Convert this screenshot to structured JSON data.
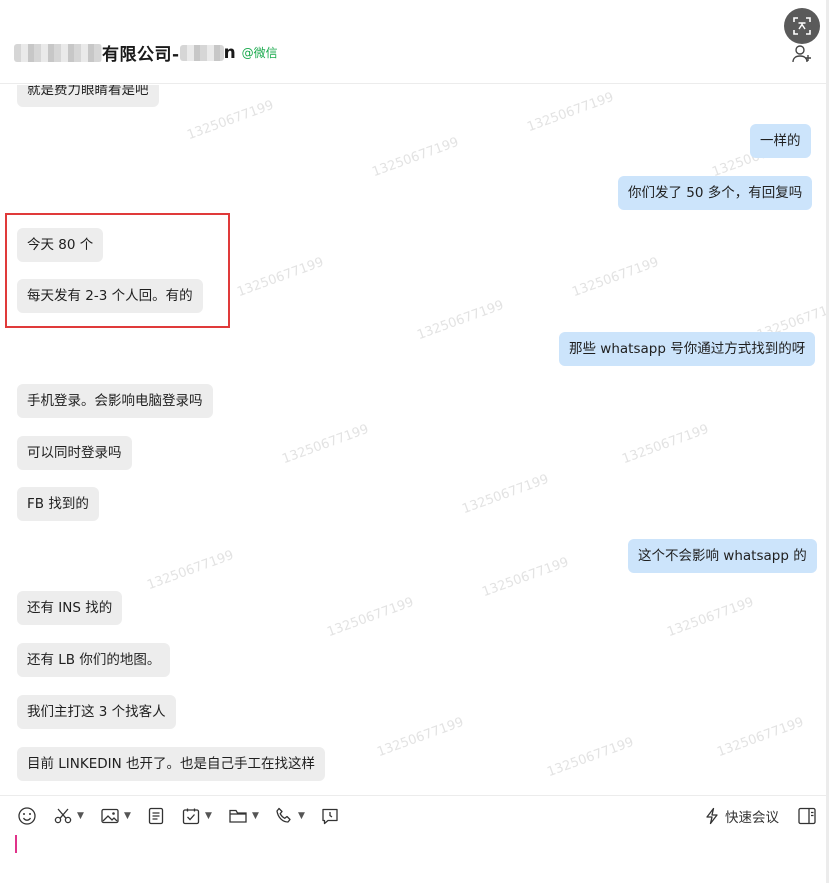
{
  "header": {
    "title": "有限公司-",
    "title_suffix": "n",
    "channel_tag": "@微信"
  },
  "watermark": "13250677199",
  "messages": [
    {
      "side": "left",
      "text": "就是费力眼睛看是吧"
    },
    {
      "side": "right",
      "text": "一样的"
    },
    {
      "side": "right",
      "text": "你们发了 50 多个，有回复吗"
    },
    {
      "side": "left",
      "text": "今天 80 个"
    },
    {
      "side": "left",
      "text": "每天发有 2-3 个人回。有的"
    },
    {
      "side": "right",
      "text": "那些 whatsapp 号你通过方式找到的呀"
    },
    {
      "side": "left",
      "text": "手机登录。会影响电脑登录吗"
    },
    {
      "side": "left",
      "text": "可以同时登录吗"
    },
    {
      "side": "left",
      "text": "FB 找到的"
    },
    {
      "side": "right",
      "text": "这个不会影响 whatsapp 的"
    },
    {
      "side": "left",
      "text": "还有 INS 找的"
    },
    {
      "side": "left",
      "text": "还有 LB 你们的地图。"
    },
    {
      "side": "left",
      "text": "我们主打这 3 个找客人"
    },
    {
      "side": "left",
      "text": "目前 LINKEDIN 也开了。也是自己手工在找这样"
    }
  ],
  "toolbar": {
    "meeting_label": "快速会议"
  },
  "colors": {
    "left_bubble": "#ededed",
    "right_bubble": "#cce4fb",
    "highlight_box": "#e03a3a",
    "channel_tag": "#19a94c",
    "cursor": "#e0338a"
  }
}
